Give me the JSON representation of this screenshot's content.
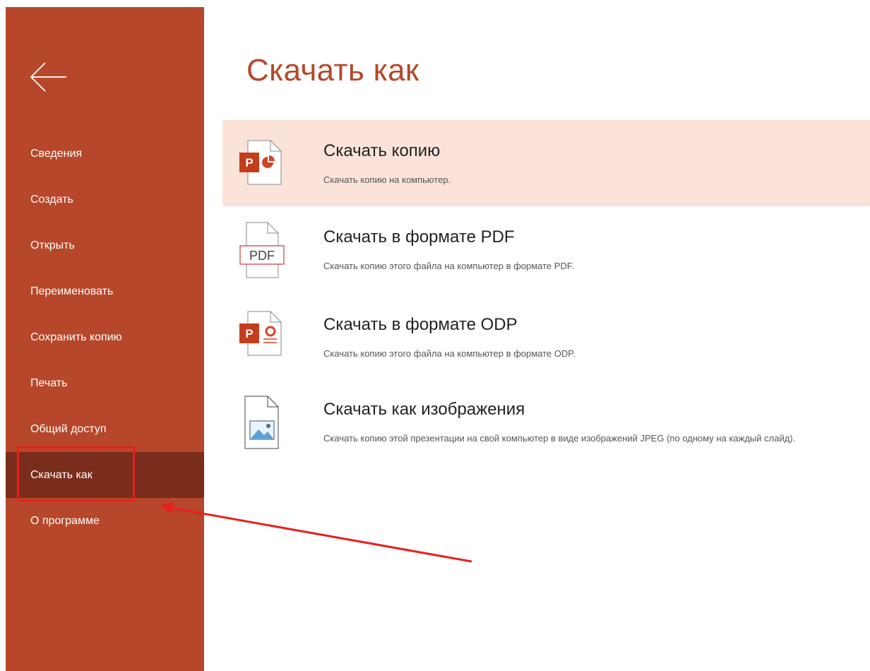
{
  "sidebar": {
    "items": [
      {
        "label": "Сведения",
        "active": false
      },
      {
        "label": "Создать",
        "active": false
      },
      {
        "label": "Открыть",
        "active": false
      },
      {
        "label": "Переименовать",
        "active": false
      },
      {
        "label": "Сохранить копию",
        "active": false
      },
      {
        "label": "Печать",
        "active": false
      },
      {
        "label": "Общий доступ",
        "active": false
      },
      {
        "label": "Скачать как",
        "active": true
      },
      {
        "label": "О программе",
        "active": false
      }
    ]
  },
  "main": {
    "title": "Скачать как",
    "options": [
      {
        "title": "Скачать копию",
        "description": "Скачать копию на компьютер.",
        "icon": "powerpoint-file-icon",
        "selected": true
      },
      {
        "title": "Скачать в формате PDF",
        "description": "Скачать копию этого файла на компьютер в формате PDF.",
        "icon": "pdf-file-icon",
        "badge": "PDF",
        "selected": false
      },
      {
        "title": "Скачать в формате ODP",
        "description": "Скачать копию этого файла на компьютер в формате ODP.",
        "icon": "odp-file-icon",
        "selected": false
      },
      {
        "title": "Скачать как изображения",
        "description": "Скачать копию этой презентации на свой компьютер в виде изображений JPEG (по одному на каждый слайд).",
        "icon": "image-file-icon",
        "selected": false
      }
    ]
  },
  "icons": {
    "ppt_letter": "P"
  },
  "colors": {
    "sidebar_bg": "#b7472a",
    "sidebar_active": "#7a2d1a",
    "title": "#b7472a",
    "selected_bg": "#fbe3da",
    "annotation": "#e8201d"
  }
}
